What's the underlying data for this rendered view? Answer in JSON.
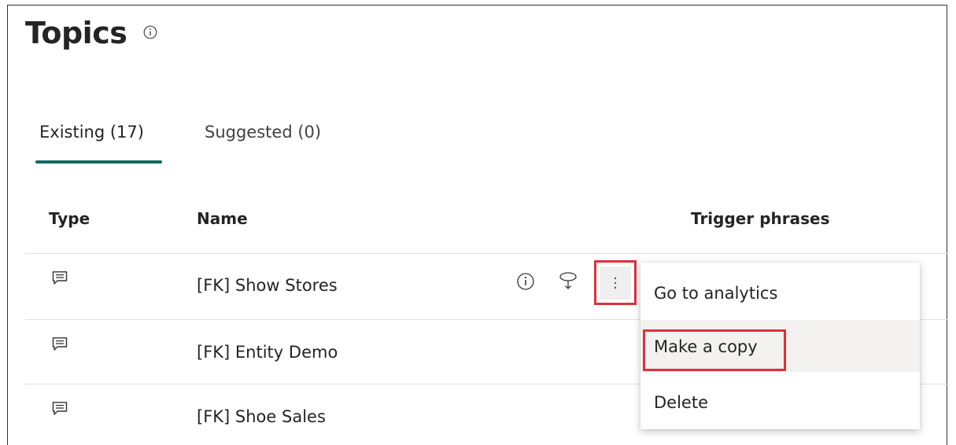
{
  "header": {
    "title": "Topics",
    "info_icon": "info-icon"
  },
  "tabs": [
    {
      "label": "Existing (17)",
      "selected": true
    },
    {
      "label": "Suggested (0)",
      "selected": false
    }
  ],
  "table": {
    "columns": [
      "Type",
      "Name",
      "Trigger phrases"
    ],
    "rows": [
      {
        "type_icon": "chat-topic-icon",
        "name": "[FK] Show Stores"
      },
      {
        "type_icon": "chat-topic-icon",
        "name": "[FK] Entity Demo"
      },
      {
        "type_icon": "chat-topic-icon",
        "name": "[FK] Shoe Sales"
      }
    ],
    "row_actions": [
      "info-icon",
      "test-icon",
      "more-options-icon"
    ]
  },
  "context_menu": {
    "items": [
      {
        "label": "Go to analytics"
      },
      {
        "label": "Make a copy",
        "highlighted": true
      },
      {
        "label": "Delete"
      }
    ]
  },
  "colors": {
    "accent": "#106b62",
    "highlight_box": "#e0303a",
    "text": "#242424",
    "divider": "#e1e1e1"
  }
}
